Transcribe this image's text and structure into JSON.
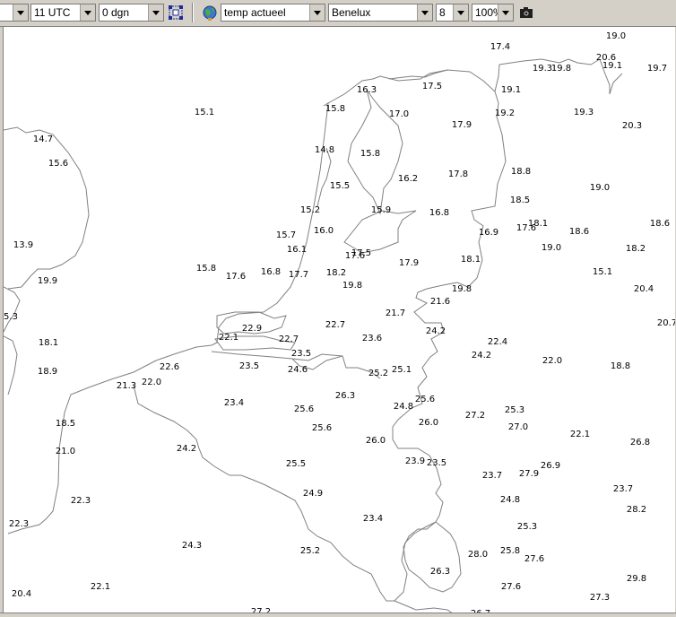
{
  "toolbar": {
    "first_combo_value": "",
    "time_value": "11 UTC",
    "day_value": "0 dgn",
    "parameter_value": "temp actueel",
    "region_value": "Benelux",
    "size_value": "8",
    "zoom_value": "100%",
    "icons": {
      "fit": "fit-to-window-icon",
      "globe": "globe-layer-icon",
      "camera": "camera-snapshot-icon"
    }
  },
  "map": {
    "coastline_color": "#808080",
    "stations": [
      {
        "label": "19.0"
      },
      {
        "label": "17.4"
      },
      {
        "label": "20.6"
      },
      {
        "label": "19.3"
      },
      {
        "label": "19.8"
      },
      {
        "label": "19.1"
      },
      {
        "label": "19.7"
      },
      {
        "label": "16.3"
      },
      {
        "label": "17.5"
      },
      {
        "label": "19.1"
      },
      {
        "label": "15.1"
      },
      {
        "label": "15.8"
      },
      {
        "label": "17.0"
      },
      {
        "label": "19.2"
      },
      {
        "label": "19.3"
      },
      {
        "label": "17.9"
      },
      {
        "label": "20.3"
      },
      {
        "label": "14.7"
      },
      {
        "label": "14.8"
      },
      {
        "label": "15.8"
      },
      {
        "label": "15.6"
      },
      {
        "label": "17.8"
      },
      {
        "label": "18.8"
      },
      {
        "label": "16.2"
      },
      {
        "label": "15.5"
      },
      {
        "label": "19.0"
      },
      {
        "label": "18.5"
      },
      {
        "label": "15.9"
      },
      {
        "label": "15.2"
      },
      {
        "label": "16.8"
      },
      {
        "label": "18.1"
      },
      {
        "label": "18.6"
      },
      {
        "label": "16.0"
      },
      {
        "label": "16.9"
      },
      {
        "label": "17.6"
      },
      {
        "label": "15.7"
      },
      {
        "label": "18.6"
      },
      {
        "label": "13.9"
      },
      {
        "label": "16.1"
      },
      {
        "label": "19.0"
      },
      {
        "label": "18.2"
      },
      {
        "label": "17.5"
      },
      {
        "label": "17.6"
      },
      {
        "label": "18.1"
      },
      {
        "label": "17.9"
      },
      {
        "label": "15.8"
      },
      {
        "label": "17.6"
      },
      {
        "label": "16.8"
      },
      {
        "label": "17.7"
      },
      {
        "label": "18.2"
      },
      {
        "label": "19.8"
      },
      {
        "label": "15.1"
      },
      {
        "label": "19.9"
      },
      {
        "label": "19.8"
      },
      {
        "label": "20.4"
      },
      {
        "label": "21.6"
      },
      {
        "label": "5.3"
      },
      {
        "label": "21.7"
      },
      {
        "label": "20.7"
      },
      {
        "label": "22.7"
      },
      {
        "label": "22.9"
      },
      {
        "label": "24.2"
      },
      {
        "label": "22.1"
      },
      {
        "label": "22.7"
      },
      {
        "label": "23.6"
      },
      {
        "label": "22.4"
      },
      {
        "label": "18.1"
      },
      {
        "label": "23.5"
      },
      {
        "label": "24.2"
      },
      {
        "label": "22.0"
      },
      {
        "label": "22.6"
      },
      {
        "label": "23.5"
      },
      {
        "label": "18.8"
      },
      {
        "label": "24.6"
      },
      {
        "label": "25.1"
      },
      {
        "label": "18.9"
      },
      {
        "label": "25.2"
      },
      {
        "label": "21.3"
      },
      {
        "label": "22.0"
      },
      {
        "label": "26.3"
      },
      {
        "label": "23.4"
      },
      {
        "label": "25.6"
      },
      {
        "label": "25.6"
      },
      {
        "label": "24.8"
      },
      {
        "label": "25.3"
      },
      {
        "label": "27.2"
      },
      {
        "label": "18.5"
      },
      {
        "label": "26.0"
      },
      {
        "label": "25.6"
      },
      {
        "label": "27.0"
      },
      {
        "label": "22.1"
      },
      {
        "label": "26.0"
      },
      {
        "label": "26.8"
      },
      {
        "label": "21.0"
      },
      {
        "label": "24.2"
      },
      {
        "label": "23.9"
      },
      {
        "label": "23.5"
      },
      {
        "label": "25.5"
      },
      {
        "label": "26.9"
      },
      {
        "label": "23.7"
      },
      {
        "label": "27.9"
      },
      {
        "label": "23.7"
      },
      {
        "label": "24.9"
      },
      {
        "label": "22.3"
      },
      {
        "label": "24.8"
      },
      {
        "label": "28.2"
      },
      {
        "label": "23.4"
      },
      {
        "label": "22.3"
      },
      {
        "label": "25.3"
      },
      {
        "label": "24.3"
      },
      {
        "label": "25.2"
      },
      {
        "label": "28.0"
      },
      {
        "label": "25.8"
      },
      {
        "label": "27.6"
      },
      {
        "label": "26.3"
      },
      {
        "label": "29.8"
      },
      {
        "label": "22.1"
      },
      {
        "label": "27.6"
      },
      {
        "label": "20.4"
      },
      {
        "label": "27.3"
      },
      {
        "label": "27.2"
      },
      {
        "label": "26.7"
      }
    ]
  }
}
